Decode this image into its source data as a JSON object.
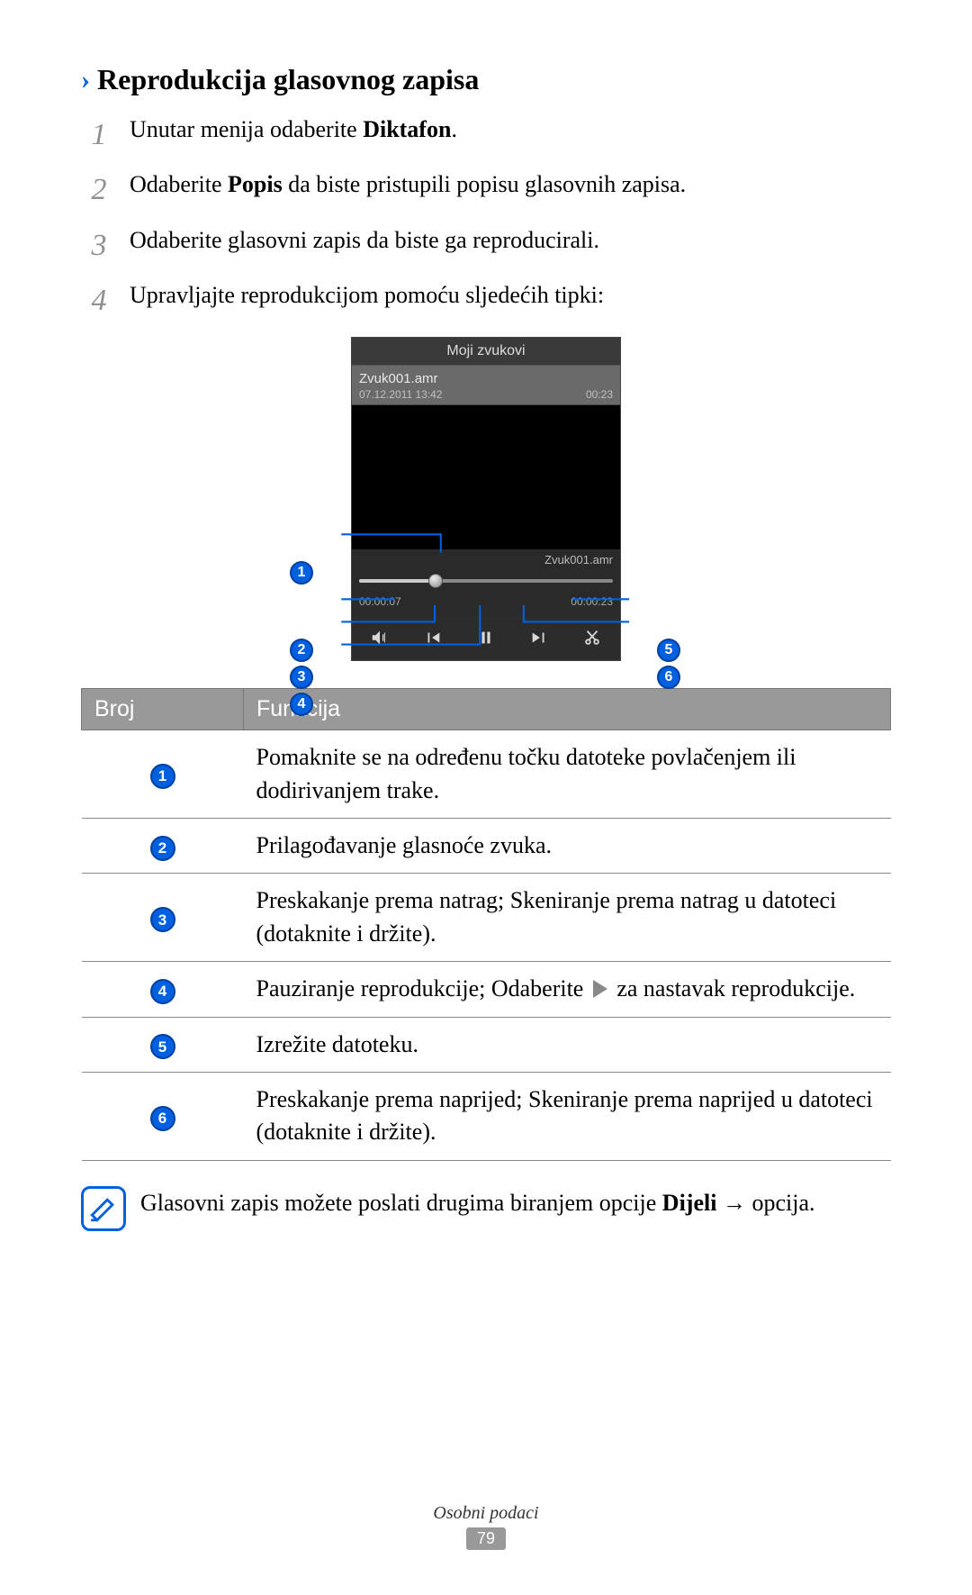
{
  "title": "Reprodukcija glasovnog zapisa",
  "steps": [
    {
      "num": "1",
      "pre": "Unutar menija odaberite ",
      "bold": "Diktafon",
      "post": "."
    },
    {
      "num": "2",
      "pre": "Odaberite ",
      "bold": "Popis",
      "post": " da biste pristupili popisu glasovnih zapisa."
    },
    {
      "num": "3",
      "pre": "Odaberite glasovni zapis da biste ga reproducirali.",
      "bold": "",
      "post": ""
    },
    {
      "num": "4",
      "pre": "Upravljajte reprodukcijom pomoću sljedećih tipki:",
      "bold": "",
      "post": ""
    }
  ],
  "phone": {
    "title": "Moji zvukovi",
    "file_name": "Zvuk001.amr",
    "file_date": "07.12.2011 13:42",
    "file_dur": "00:23",
    "now_playing": "Zvuk001.amr",
    "elapsed": "00:00:07",
    "total": "00:00:23"
  },
  "callouts": [
    "1",
    "2",
    "3",
    "4",
    "5",
    "6"
  ],
  "table": {
    "h1": "Broj",
    "h2": "Funkcija",
    "rows": [
      {
        "n": "1",
        "text": "Pomaknite se na određenu točku datoteke povlačenjem ili dodirivanjem trake."
      },
      {
        "n": "2",
        "text": "Prilagođavanje glasnoće zvuka."
      },
      {
        "n": "3",
        "text": "Preskakanje prema natrag; Skeniranje prema natrag u datoteci (dotaknite i držite)."
      },
      {
        "n": "4",
        "text_pre": "Pauziranje reprodukcije; Odaberite ",
        "text_post": " za nastavak reprodukcije."
      },
      {
        "n": "5",
        "text": "Izrežite datoteku."
      },
      {
        "n": "6",
        "text": "Preskakanje prema naprijed; Skeniranje prema naprijed u datoteci (dotaknite i držite)."
      }
    ]
  },
  "note": {
    "pre": "Glasovni zapis možete poslati drugima biranjem opcije ",
    "bold": "Dijeli",
    "post": " → opcija."
  },
  "footer": {
    "section": "Osobni podaci",
    "page": "79"
  }
}
